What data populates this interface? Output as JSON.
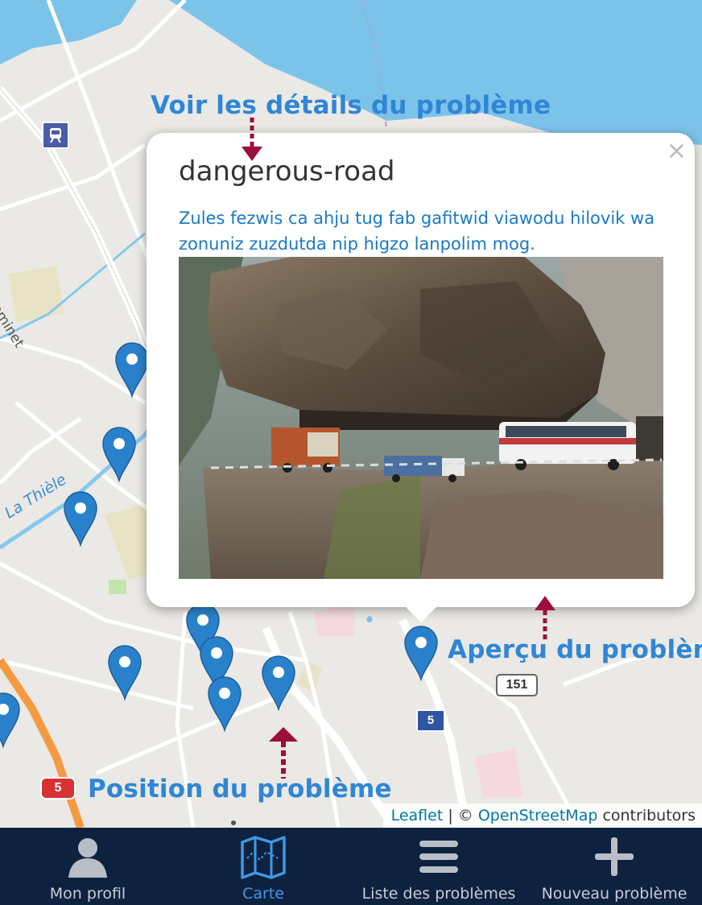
{
  "map": {
    "street_label_1": "La Thièle",
    "street_label_2": "Cheminet",
    "road_shield_5_red": "5",
    "road_shield_5_blue": "5",
    "road_shield_151": "151",
    "train_icon": "train-station-icon"
  },
  "annotations": {
    "details": "Voir les détails du problème",
    "preview": "Aperçu du problème",
    "position": "Position du problème"
  },
  "popup": {
    "title": "dangerous-road",
    "description": "Zules fezwis ca ahju tug fab gafitwid viawodu hilovik wa zonuniz zuzdutda nip higzo lanpolim mog.",
    "close_symbol": "×"
  },
  "attribution": {
    "leaflet": "Leaflet",
    "separator": " | © ",
    "osm": "OpenStreetMap",
    "contributors": " contributors"
  },
  "nav": {
    "items": [
      {
        "label": "Mon profil",
        "icon": "user-icon",
        "active": false
      },
      {
        "label": "Carte",
        "icon": "map-icon",
        "active": true
      },
      {
        "label": "Liste des problèmes",
        "icon": "list-icon",
        "active": false
      },
      {
        "label": "Nouveau problème",
        "icon": "plus-icon",
        "active": false
      }
    ]
  },
  "colors": {
    "water": "#7cc3ea",
    "marker": "#2a81cb",
    "annotation": "#2f86d6",
    "arrow": "#9b0f3a",
    "nav_bg": "#0e2240",
    "nav_active": "#3c9ae6"
  }
}
